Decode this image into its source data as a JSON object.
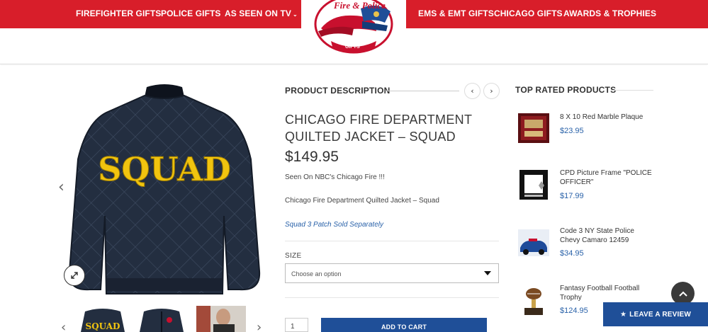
{
  "nav": {
    "left": [
      "FIREFIGHTER GIFTS",
      "POLICE GIFTS",
      "AS SEEN ON TV"
    ],
    "caret": "⌄",
    "right": [
      "EMS & EMT GIFTS",
      "CHICAGO GIFTS",
      "AWARDS & TROPHIES"
    ]
  },
  "logo": {
    "line1": "Fire & Police",
    "line2": "GIFTS"
  },
  "gallery": {
    "jacket_text": "SQUAD",
    "thumb_text": "SQUAD"
  },
  "product": {
    "section_label": "PRODUCT DESCRIPTION",
    "title_line1": "CHICAGO FIRE DEPARTMENT",
    "title_line2": "QUILTED JACKET – SQUAD",
    "price": "$149.95",
    "seen_on": "Seen On NBC's Chicago Fire !!!",
    "short_desc": "Chicago Fire Department Quilted Jacket – Squad",
    "note": "Squad 3 Patch Sold Separately",
    "size_label": "SIZE",
    "size_placeholder": "Choose an option",
    "quantity": "1",
    "add_to_cart": "ADD TO CART"
  },
  "sidebar": {
    "title": "TOP RATED PRODUCTS",
    "items": [
      {
        "name": "8 X 10 Red Marble Plaque",
        "price": "$23.95"
      },
      {
        "name": "CPD Picture Frame \"POLICE OFFICER\"",
        "price": "$17.99"
      },
      {
        "name": "Code 3 NY State Police Chevy Camaro 12459",
        "price": "$34.95"
      },
      {
        "name": "Fantasy Football Football Trophy",
        "price": "$124.95"
      }
    ]
  },
  "review_button": "LEAVE A REVIEW",
  "colors": {
    "brand_red": "#d81e2a",
    "brand_blue": "#1f4f98",
    "link_blue": "#2a62a9"
  }
}
